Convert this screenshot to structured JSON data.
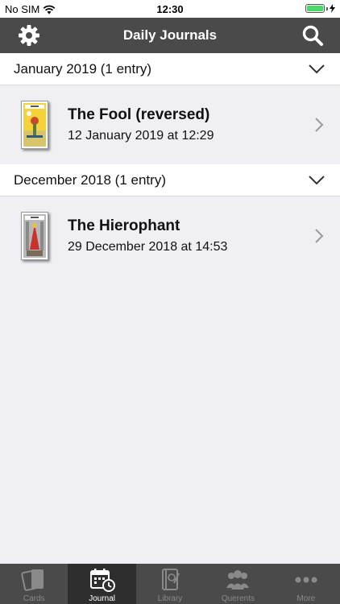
{
  "status_bar": {
    "carrier": "No SIM",
    "time": "12:30"
  },
  "nav": {
    "title": "Daily Journals",
    "left_icon": "gear-icon",
    "right_icon": "search-icon"
  },
  "sections": [
    {
      "header": "January 2019 (1 entry)",
      "entries": [
        {
          "title": "The Fool (reversed)",
          "date": "12 January 2019 at 12:29"
        }
      ]
    },
    {
      "header": "December 2018 (1 entry)",
      "entries": [
        {
          "title": "The Hierophant",
          "date": "29 December 2018 at 14:53"
        }
      ]
    }
  ],
  "tabs": [
    {
      "label": "Cards",
      "icon": "cards-icon",
      "active": false
    },
    {
      "label": "Journal",
      "icon": "calendar-clock-icon",
      "active": true
    },
    {
      "label": "Library",
      "icon": "book-icon",
      "active": false
    },
    {
      "label": "Querents",
      "icon": "people-icon",
      "active": false
    },
    {
      "label": "More",
      "icon": "ellipsis-icon",
      "active": false
    }
  ],
  "colors": {
    "bar": "#4a4a4a",
    "active_tab": "#2e2e2e",
    "background": "#efeff4",
    "battery": "#4cd964"
  }
}
